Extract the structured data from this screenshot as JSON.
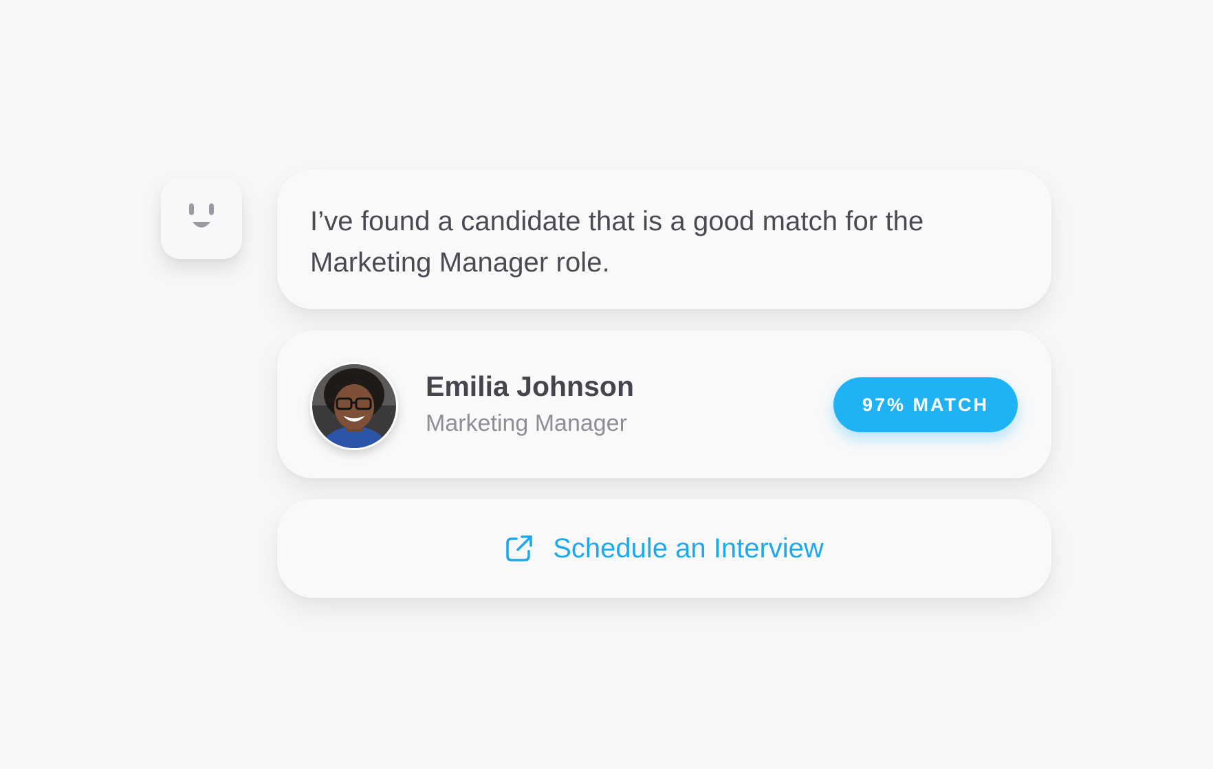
{
  "assistant": {
    "avatar_icon": "smiley-face-icon"
  },
  "message": {
    "text": "I’ve found a candidate that is a good match for the Marketing Manager role."
  },
  "candidate": {
    "name": "Emilia Johnson",
    "role": "Marketing Manager",
    "match_label": "97% MATCH",
    "match_percent": 97
  },
  "action": {
    "label": "Schedule an Interview",
    "icon": "external-link-icon"
  },
  "colors": {
    "accent": "#1fb3f5",
    "link": "#1ea9ef",
    "background": "#f7f7f9",
    "card": "#f9f9fa",
    "primary_text": "#45454d",
    "secondary_text": "#8e8e96"
  }
}
